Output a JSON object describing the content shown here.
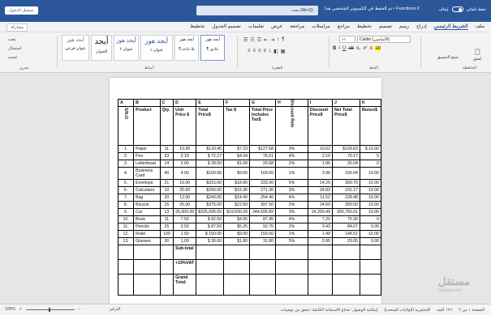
{
  "titlebar": {
    "title": "Functions 2 • تم الحفظ في الكمبيوتر الشخصي هذا",
    "search": "بحث (Alt+Q)",
    "autosave_label": "حفظ تلقائي",
    "autosave_state": "إيقاف",
    "signin": "تسجيل الدخول"
  },
  "menu": {
    "items": [
      "ملف",
      "الشريط الرئيسي",
      "إدراج",
      "رسم",
      "تصميم",
      "تخطيط",
      "مراجع",
      "مراسلات",
      "مراجعة",
      "عرض",
      "تعليمات",
      "تصميم الجدول",
      "تخطيط"
    ],
    "active_index": 1,
    "share": "مشاركة"
  },
  "ribbon": {
    "paste": "لصق",
    "clipboard": "الحافظة",
    "font_name": "Calibri (الأساسي)",
    "font_size": "١١",
    "font_group": "الخط",
    "paragraph_group": "الفقرة",
    "styles_group": "أنماط",
    "editing_group": "تحرير",
    "find": "بحث",
    "replace": "استبدال",
    "select": "تحديد",
    "format_painter": "نسخ التنسيق",
    "styles": [
      {
        "preview": "أيجد هوز",
        "name": "¶ عادي"
      },
      {
        "preview": "أيجد هوز",
        "name": "¶ بلا تباعد"
      },
      {
        "preview": "أيجد هوز",
        "name": "عنوان ١"
      },
      {
        "preview": "أيجد هوز",
        "name": "عنوان ٢"
      },
      {
        "preview": "أيجد",
        "name": "العنوان"
      },
      {
        "preview": "أيجد هوز",
        "name": "عنوان فرعي"
      }
    ]
  },
  "table": {
    "letters": [
      "A",
      "B",
      "C",
      "D",
      "E",
      "F",
      "G",
      "H",
      "I",
      "J",
      "K"
    ],
    "headers": [
      "S/N.O",
      "Product",
      "Qty.",
      "Unit Price $",
      "Total Price$",
      "Tax $",
      "Total Price Includes Tax$",
      "Discount Rate",
      "Discount Price$",
      "Net Total Price$",
      "Bonus$"
    ],
    "rows": [
      [
        "1.",
        "Paper",
        "11",
        "10.95",
        "$120.45",
        "$7.23",
        "$127.68",
        "3%",
        "10.62",
        "$109.83",
        "$ 10.00"
      ],
      [
        "2.",
        "Pen",
        "33",
        "2.19",
        "$ 72.27",
        "$4.34",
        "76.61",
        "4%",
        "2.10",
        "70.17",
        "0"
      ],
      [
        "3.",
        "Letterhead",
        "14",
        "2.00",
        "$ 28.00",
        "$1.68",
        "29.68",
        "2%",
        "1.96",
        "26.04",
        "0"
      ],
      [
        "4.",
        "Business Card",
        "40",
        "4.00",
        "$160.00",
        "$9.60",
        "169.60",
        "1%",
        "3.96",
        "156.04",
        "10.00"
      ],
      [
        "5.",
        "Envelope",
        "21",
        "15.00",
        "$315.00",
        "$18.90",
        "333.90",
        "5%",
        "14.25",
        "300.75",
        "10.00"
      ],
      [
        "6.",
        "Calculator",
        "10",
        "25.60",
        "$256.00",
        "$15.36",
        "271.36",
        "3%",
        "24.83",
        "231.17",
        "10.00"
      ],
      [
        "7.",
        "Bag",
        "20",
        "12.00",
        "$240.00",
        "$14.40",
        "254.40",
        "4%",
        "11.52",
        "228.48",
        "10.00"
      ],
      [
        "8.",
        "Bicycle",
        "15",
        "25.00",
        "$375.00",
        "$22.50",
        "397.50",
        "2%",
        "24.50",
        "350.50",
        "10.00"
      ],
      [
        "9.",
        "Car",
        "13",
        "25,000.00",
        "$325,006.50",
        "$19,500.39",
        "344,506.89",
        "3%",
        "24,250.49",
        "300,756.01",
        "10.00"
      ],
      [
        "10.",
        "Book",
        "11",
        "7.50",
        "$ 82.50",
        "$4.95",
        "87.45",
        "4%",
        "7.20",
        "75.30",
        "0"
      ],
      [
        "11.",
        "Pencils",
        "25",
        "3.50",
        "$ 87.50",
        "$5.25",
        "92.75",
        "2%",
        "3.43",
        "84.07",
        "0.00"
      ],
      [
        "12.",
        "Ruler",
        "100",
        "1.50",
        "$ 150.00",
        "$9.00",
        "159.00",
        "1%",
        "1.49",
        "148.51",
        "10.00"
      ],
      [
        "13.",
        "Glasses",
        "30",
        "1.00",
        "$ 30.00",
        "$1.80",
        "31.80",
        "5%",
        "0.95",
        "29.05",
        "0.00"
      ]
    ],
    "subtotal_label": "Sub-total",
    "vat_label": "+19%VAT",
    "grand_total_label": "Grand Total:"
  },
  "statusbar": {
    "page": "الصفحة ١ من ٢",
    "words": "١٩٦ كلمة",
    "language": "الإنجليزية (الولايات المتحدة)",
    "accessibility": "إمكانية الوصول: تحتاج الاستجابة الكاملة: تحقق من توصيات",
    "focus": "التركيز",
    "zoom": "100%"
  },
  "watermark": {
    "text": "مستقل",
    "sub": "mostaql.com"
  }
}
